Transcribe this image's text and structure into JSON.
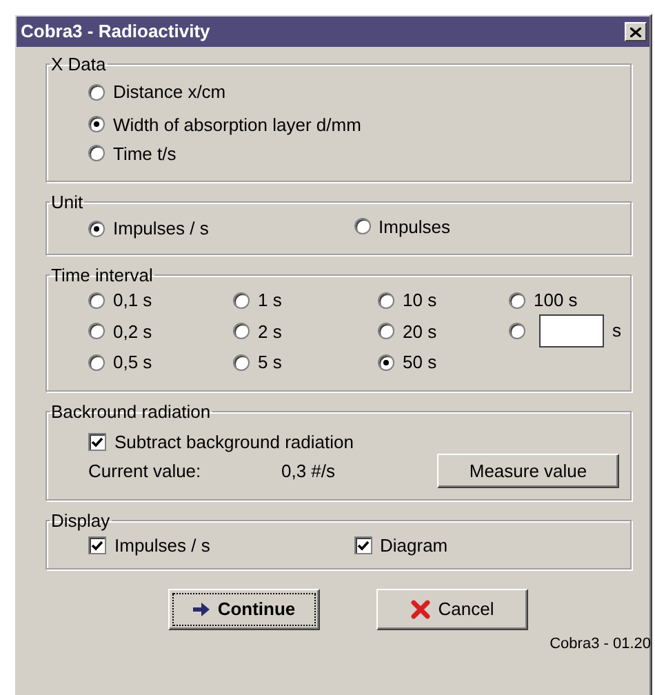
{
  "window": {
    "title": "Cobra3 - Radioactivity"
  },
  "x_data": {
    "legend": "X Data",
    "options": [
      {
        "label": "Distance x/cm",
        "selected": false
      },
      {
        "label": "Width of absorption layer d/mm",
        "selected": true
      },
      {
        "label": "Time t/s",
        "selected": false
      }
    ]
  },
  "unit": {
    "legend": "Unit",
    "options": [
      {
        "label": "Impulses / s",
        "selected": true
      },
      {
        "label": "Impulses",
        "selected": false
      }
    ]
  },
  "time_interval": {
    "legend": "Time interval",
    "options": [
      {
        "kind": "preset",
        "label": "0,1 s",
        "selected": false
      },
      {
        "kind": "preset",
        "label": "1 s",
        "selected": false
      },
      {
        "kind": "preset",
        "label": "10 s",
        "selected": false
      },
      {
        "kind": "preset",
        "label": "100 s",
        "selected": false
      },
      {
        "kind": "preset",
        "label": "0,2 s",
        "selected": false
      },
      {
        "kind": "preset",
        "label": "2 s",
        "selected": false
      },
      {
        "kind": "preset",
        "label": "20 s",
        "selected": false
      },
      {
        "kind": "custom",
        "label": "s",
        "selected": false
      },
      {
        "kind": "preset",
        "label": "0,5 s",
        "selected": false
      },
      {
        "kind": "preset",
        "label": "5 s",
        "selected": false
      },
      {
        "kind": "preset",
        "label": "50 s",
        "selected": true
      }
    ]
  },
  "background": {
    "legend": "Backround radiation",
    "subtract": {
      "label": "Subtract background radiation",
      "checked": true
    },
    "current_label": "Current value:",
    "current_value": "0,3 #/s",
    "measure_button": "Measure value"
  },
  "display": {
    "legend": "Display",
    "options": [
      {
        "label": "Impulses / s",
        "checked": true
      },
      {
        "label": "Diagram",
        "checked": true
      }
    ]
  },
  "buttons": [
    {
      "kind": "continue",
      "label": "Continue",
      "focused": true
    },
    {
      "kind": "cancel",
      "label": "Cancel",
      "focused": false
    }
  ],
  "version": "Cobra3 - 01.20"
}
